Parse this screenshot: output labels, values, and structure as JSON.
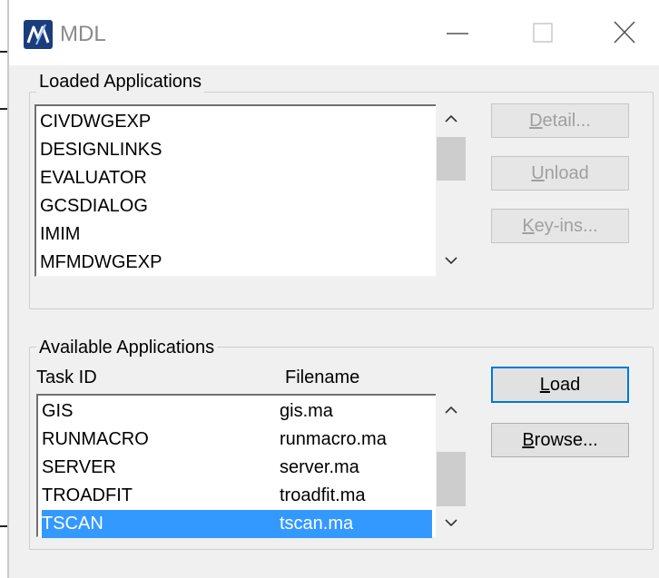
{
  "window": {
    "title": "MDL",
    "controls": {
      "minimize": "minimize-icon",
      "maximize": "maximize-icon",
      "close": "close-icon"
    }
  },
  "loaded": {
    "group_label": "Loaded Applications",
    "items": [
      "CIVDWGEXP",
      "DESIGNLINKS",
      "EVALUATOR",
      "GCSDIALOG",
      "IMIM",
      "MFMDWGEXP"
    ],
    "buttons": {
      "detail": "Detail...",
      "unload": "Unload",
      "keyins": "Key-ins..."
    }
  },
  "available": {
    "group_label": "Available Applications",
    "col_task": "Task ID",
    "col_file": "Filename",
    "rows": [
      {
        "task": "GIS",
        "file": "gis.ma"
      },
      {
        "task": "RUNMACRO",
        "file": "runmacro.ma"
      },
      {
        "task": "SERVER",
        "file": "server.ma"
      },
      {
        "task": "TROADFIT",
        "file": "troadfit.ma"
      },
      {
        "task": "TSCAN",
        "file": "tscan.ma",
        "selected": true
      }
    ],
    "buttons": {
      "load": "Load",
      "browse": "Browse..."
    }
  },
  "colors": {
    "selection": "#3399ff",
    "default_button_border": "#0078d7",
    "dialog_bg": "#f0f0f0"
  }
}
